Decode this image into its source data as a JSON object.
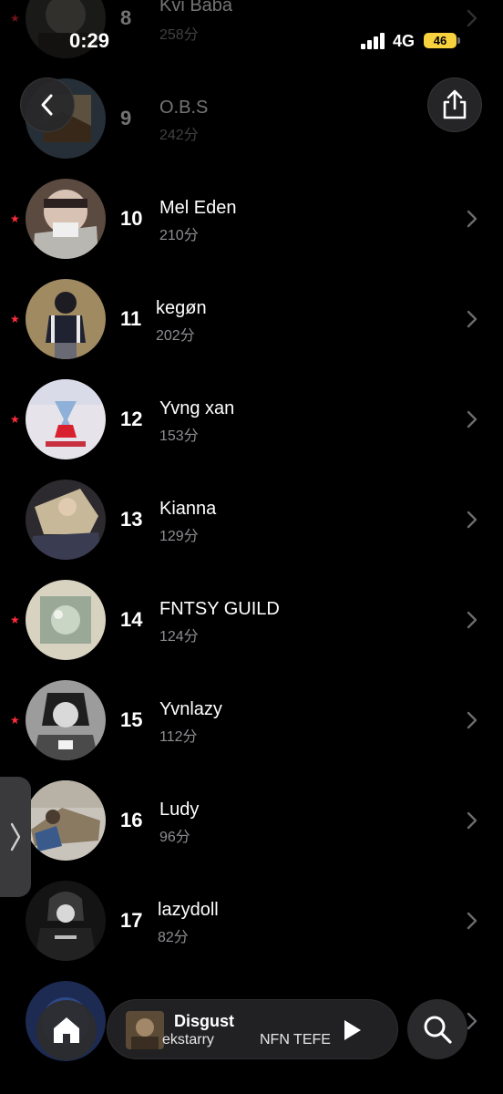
{
  "status_bar": {
    "time": "0:29",
    "network": "4G",
    "battery": "46"
  },
  "rows": [
    {
      "rank": "8",
      "name": "Kvi Baba",
      "score": "258分",
      "starred": true,
      "dim": true,
      "avatar": "avatar-kvi-baba"
    },
    {
      "rank": "9",
      "name": "O.B.S",
      "score": "242分",
      "starred": false,
      "dim": true,
      "avatar": "avatar-obs"
    },
    {
      "rank": "10",
      "name": "Mel Eden",
      "score": "210分",
      "starred": true,
      "dim": false,
      "avatar": "avatar-mel-eden"
    },
    {
      "rank": "11",
      "name": "kegøn",
      "score": "202分",
      "starred": true,
      "dim": false,
      "avatar": "avatar-kegon"
    },
    {
      "rank": "12",
      "name": "Yvng xan",
      "score": "153分",
      "starred": true,
      "dim": false,
      "avatar": "avatar-yvng-xan"
    },
    {
      "rank": "13",
      "name": "Kianna",
      "score": "129分",
      "starred": false,
      "dim": false,
      "avatar": "avatar-kianna"
    },
    {
      "rank": "14",
      "name": "FNTSY GUILD",
      "score": "124分",
      "starred": true,
      "dim": false,
      "avatar": "avatar-fntsy-guild"
    },
    {
      "rank": "15",
      "name": "Yvnlazy",
      "score": "112分",
      "starred": true,
      "dim": false,
      "avatar": "avatar-yvnlazy"
    },
    {
      "rank": "16",
      "name": "Ludy",
      "score": "96分",
      "starred": false,
      "dim": false,
      "avatar": "avatar-ludy"
    },
    {
      "rank": "17",
      "name": "lazydoll",
      "score": "82分",
      "starred": false,
      "dim": false,
      "avatar": "avatar-lazydoll"
    }
  ],
  "player": {
    "title": "Disgust",
    "artist": "ekstarry",
    "artist_secondary": "NFN TEFE"
  },
  "icons": {
    "back": "chevron-left-icon",
    "share": "share-icon",
    "side_tab": "chevron-right-icon",
    "home": "home-icon",
    "play": "play-icon",
    "search": "search-icon",
    "star": "star-icon",
    "row_chevron": "chevron-right-icon"
  },
  "colors": {
    "star": "#ff2d3b",
    "battery": "#f7d23e",
    "secondary_text": "#8e8e93"
  }
}
